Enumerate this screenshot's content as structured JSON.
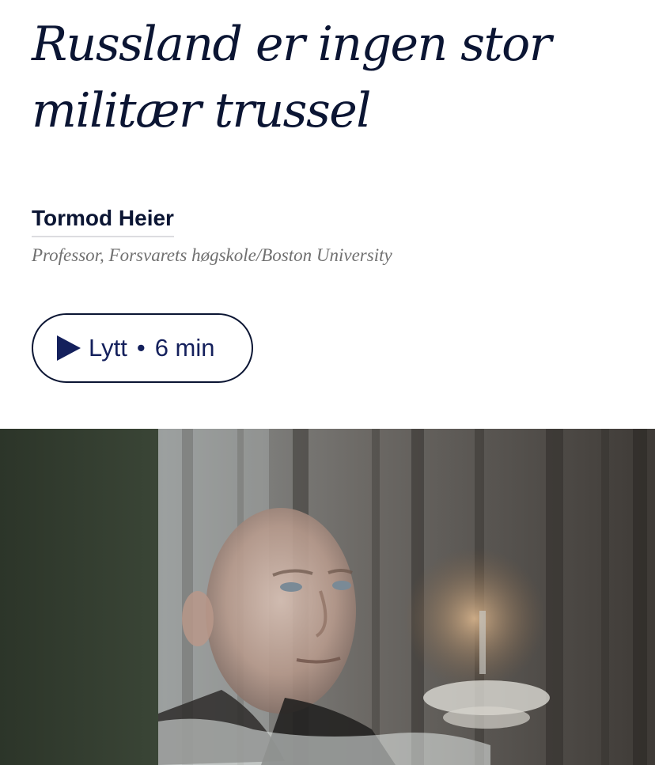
{
  "article": {
    "headline": "Russland er ingen stor militær trussel",
    "author": {
      "name": "Tormod Heier",
      "title": "Professor, Forsvarets høgskole/Boston University"
    },
    "listen": {
      "icon": "play-icon",
      "label": "Lytt",
      "separator": "•",
      "duration": "6 min"
    },
    "photo": {
      "subject": "man looking out through a window reflecting a winter forest"
    }
  },
  "colors": {
    "headline": "#0b1533",
    "accent": "#14205c",
    "subtitle": "#707070",
    "background": "#ffffff"
  }
}
